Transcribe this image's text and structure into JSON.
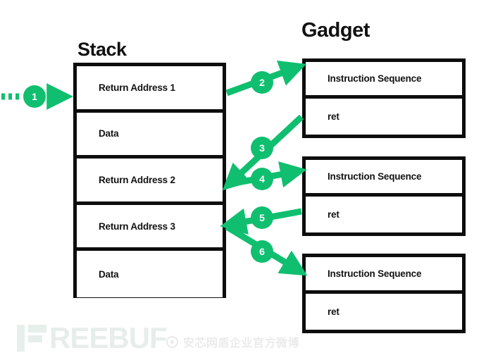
{
  "diagram": {
    "title_stack": "Stack",
    "title_gadget": "Gadget",
    "accent_color": "#0fbf6f",
    "line_color": "#0d0d0d",
    "background": "#ffffff"
  },
  "stack": {
    "label": "Stack",
    "cells": [
      {
        "text": "Return Address 1"
      },
      {
        "text": "Data"
      },
      {
        "text": "Return Address 2"
      },
      {
        "text": "Return Address 3"
      },
      {
        "text": "Data"
      }
    ]
  },
  "gadgets": [
    {
      "rows": [
        {
          "text": "Instruction Sequence"
        },
        {
          "text": "ret"
        }
      ]
    },
    {
      "rows": [
        {
          "text": "Instruction Sequence"
        },
        {
          "text": "ret"
        }
      ]
    },
    {
      "rows": [
        {
          "text": "Instruction Sequence"
        },
        {
          "text": "ret"
        }
      ]
    }
  ],
  "steps": [
    {
      "number": "1",
      "from": "entry",
      "to": "Return Address 1",
      "style": "dashed"
    },
    {
      "number": "2",
      "from": "Return Address 1",
      "to": "Gadget 1 Instruction Sequence",
      "style": "solid"
    },
    {
      "number": "3",
      "from": "Gadget 1 ret",
      "to": "Return Address 2",
      "style": "solid"
    },
    {
      "number": "4",
      "from": "Return Address 2",
      "to": "Gadget 2 Instruction Sequence",
      "style": "solid"
    },
    {
      "number": "5",
      "from": "Gadget 2 ret",
      "to": "Return Address 3",
      "style": "solid"
    },
    {
      "number": "6",
      "from": "Return Address 3",
      "to": "Gadget 3 Instruction Sequence",
      "style": "solid"
    }
  ],
  "watermarks": {
    "freebuf": "REEBUF",
    "weibo": "安芯网盾企业官方微博"
  }
}
